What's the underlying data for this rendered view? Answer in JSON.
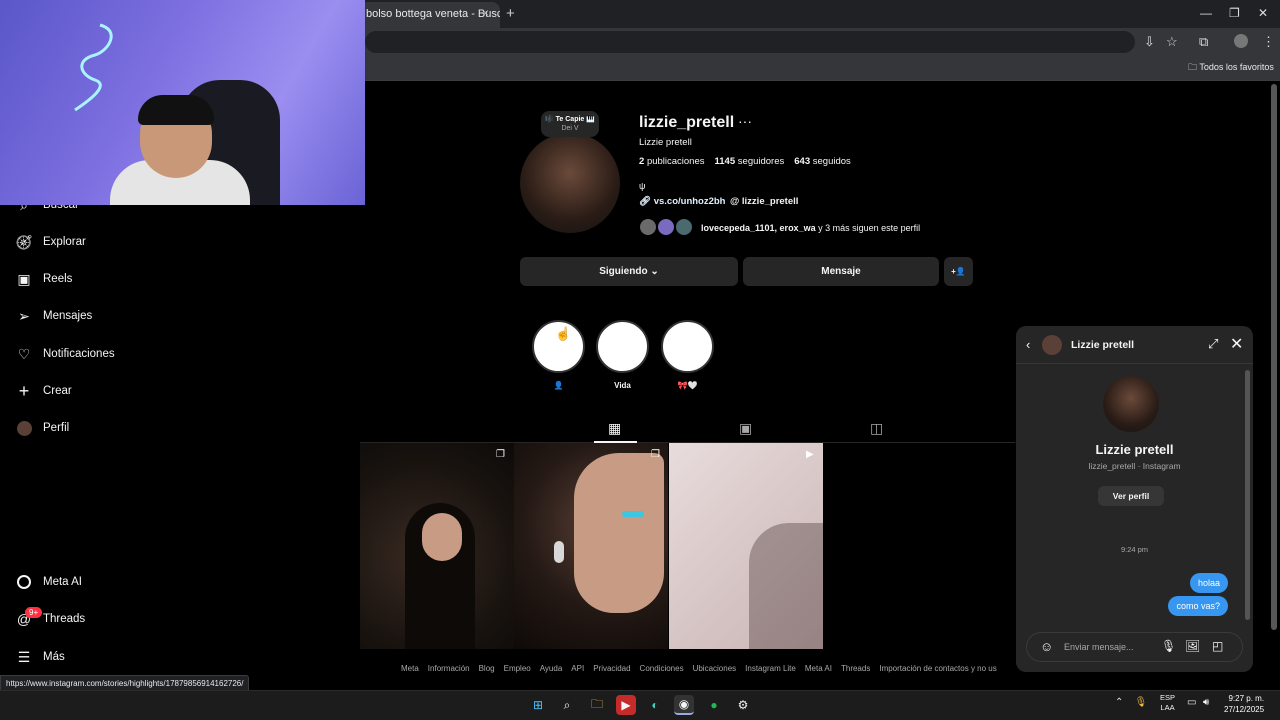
{
  "browser": {
    "tab_title": "bolso bottega veneta - Buscar",
    "tab_close": "×",
    "new_tab": "+",
    "bookmarks_label": "Todos los favoritos",
    "status_url": "https://www.instagram.com/stories/highlights/17879856914162726/"
  },
  "sidebar": {
    "items": [
      {
        "label": "Buscar",
        "icon": "search-icon"
      },
      {
        "label": "Explorar",
        "icon": "compass-icon"
      },
      {
        "label": "Reels",
        "icon": "reels-icon"
      },
      {
        "label": "Mensajes",
        "icon": "messages-icon"
      },
      {
        "label": "Notificaciones",
        "icon": "heart-icon"
      },
      {
        "label": "Crear",
        "icon": "plus-icon"
      },
      {
        "label": "Perfil",
        "icon": "avatar"
      }
    ],
    "bottom_items": [
      {
        "label": "Meta AI",
        "icon": "meta-ai-icon"
      },
      {
        "label": "Threads",
        "icon": "threads-icon"
      },
      {
        "label": "Más",
        "icon": "menu-icon"
      }
    ],
    "threads_badge": "9+"
  },
  "profile": {
    "note_line1": "🎼 Te Capie 🎹",
    "note_line2": "Dei V",
    "username": "lizzie_pretell",
    "more": "···",
    "full_name": "Lizzie pretell",
    "posts_count": "2",
    "posts_label": "publicaciones",
    "followers_count": "1145",
    "followers_label": "seguidores",
    "following_count": "643",
    "following_label": "seguidos",
    "bio_symbol": "ψ",
    "link": "vs.co/unhoz2bh",
    "threads_handle": "lizzie_pretell",
    "followed_by_names": "lovecepeda_1101, erox_wa",
    "followed_by_rest": " y 3 más siguen este perfil",
    "following_button": "Siguiendo",
    "message_button": "Mensaje",
    "add_person_icon": "+👤"
  },
  "highlights": [
    {
      "label": "👤"
    },
    {
      "label": "Vida"
    },
    {
      "label": "🎀🤍"
    }
  ],
  "footer_links": [
    "Meta",
    "Información",
    "Blog",
    "Empleo",
    "Ayuda",
    "API",
    "Privacidad",
    "Condiciones",
    "Ubicaciones",
    "Instagram Lite",
    "Meta AI",
    "Threads",
    "Importación de contactos y no us"
  ],
  "chat": {
    "title": "Lizzie pretell",
    "name": "Lizzie pretell",
    "subtitle": "lizzie_pretell · Instagram",
    "view_profile": "Ver perfil",
    "time": "9:24 pm",
    "messages": [
      "holaa",
      "como vas?"
    ],
    "input_placeholder": "Enviar mensaje..."
  },
  "taskbar": {
    "lang_line1": "ESP",
    "lang_line2": "LAA",
    "time": "9:27 p. m.",
    "date": "27/12/2025"
  }
}
